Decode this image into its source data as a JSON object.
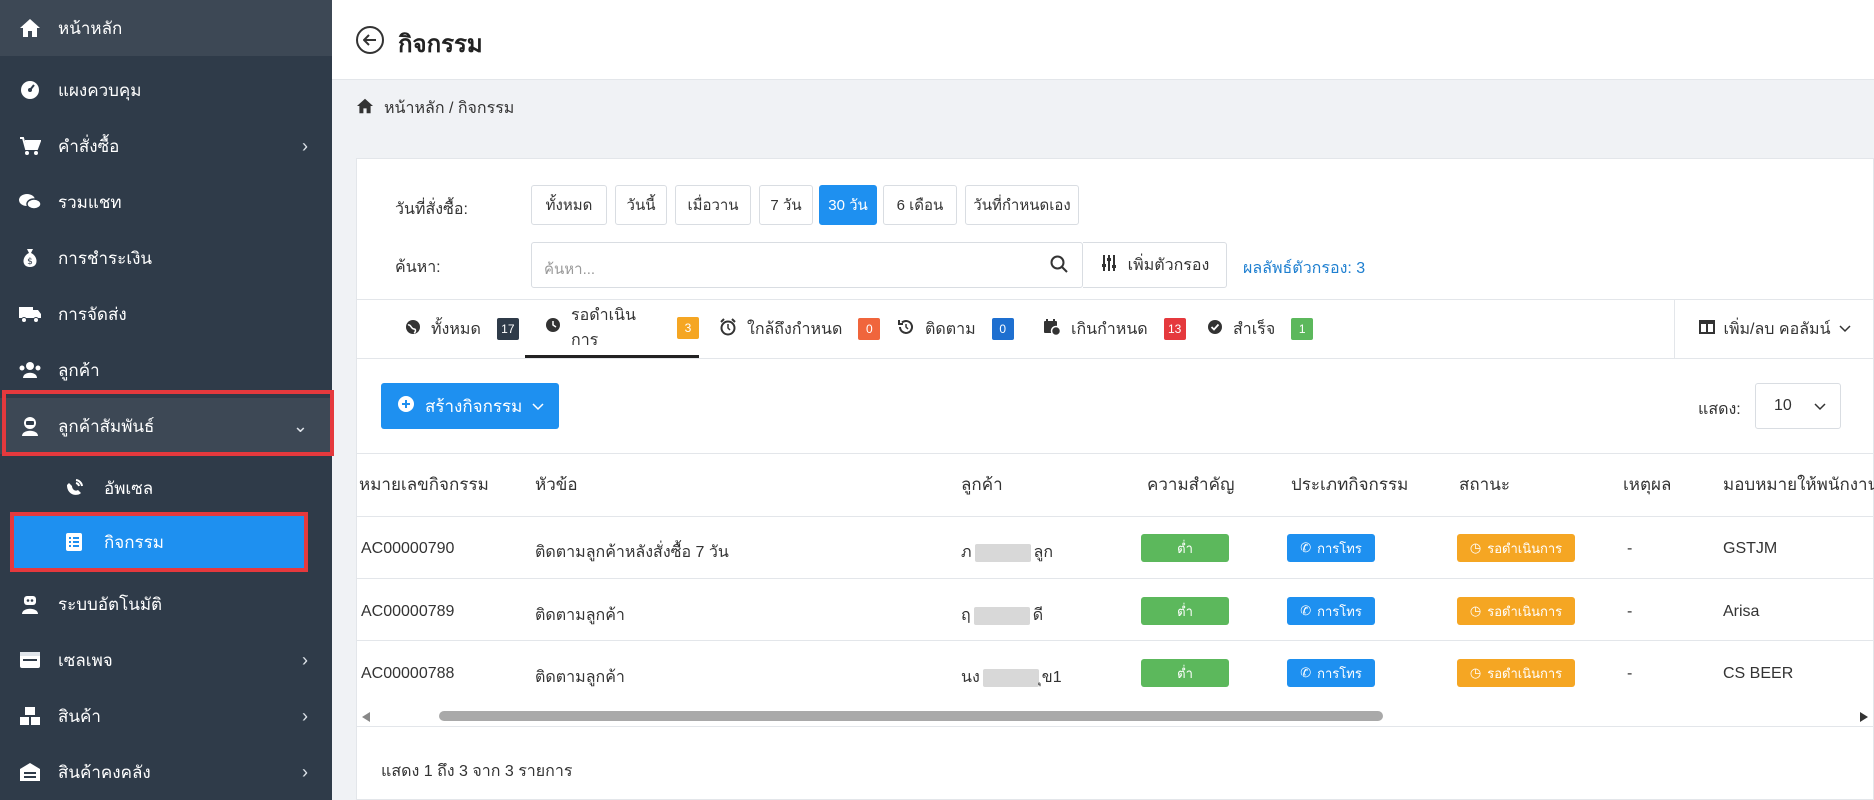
{
  "sidebar": {
    "items": [
      {
        "label": "หน้าหลัก",
        "icon": "home-icon"
      },
      {
        "label": "แผงควบคุม",
        "icon": "dashboard-icon"
      },
      {
        "label": "คำสั่งซื้อ",
        "icon": "cart-icon"
      },
      {
        "label": "รวมแชท",
        "icon": "chat-icon"
      },
      {
        "label": "การชำระเงิน",
        "icon": "money-bag-icon"
      },
      {
        "label": "การจัดส่ง",
        "icon": "truck-icon"
      },
      {
        "label": "ลูกค้า",
        "icon": "users-icon"
      },
      {
        "label": "ลูกค้าสัมพันธ์",
        "icon": "crm-icon"
      },
      {
        "label": "ระบบอัตโนมัติ",
        "icon": "robot-icon"
      },
      {
        "label": "เซลเพจ",
        "icon": "browser-icon"
      },
      {
        "label": "สินค้า",
        "icon": "boxes-icon"
      },
      {
        "label": "สินค้าคงคลัง",
        "icon": "warehouse-icon"
      }
    ],
    "sub_items": [
      {
        "label": "อัพเซล",
        "icon": "upsell-icon"
      },
      {
        "label": "กิจกรรม",
        "icon": "activity-list-icon"
      }
    ]
  },
  "header": {
    "title": "กิจกรรม"
  },
  "breadcrumb": {
    "text": "หน้าหลัก / กิจกรรม"
  },
  "filters": {
    "date_label": "วันที่สั่งซื้อ:",
    "date_options": [
      "ทั้งหมด",
      "วันนี้",
      "เมื่อวาน",
      "7 วัน",
      "30 วัน",
      "6 เดือน",
      "วันที่กำหนดเอง"
    ],
    "selected_date": "30 วัน",
    "search_label": "ค้นหา:",
    "search_placeholder": "ค้นหา...",
    "add_filter_label": "เพิ่มตัวกรอง",
    "filter_result": "ผลลัพธ์ตัวกรอง: 3"
  },
  "tabs": [
    {
      "label": "ทั้งหมด",
      "count": "17",
      "color": "#2f3b49"
    },
    {
      "label": "รอดำเนินการ",
      "count": "3",
      "color": "#f5a623"
    },
    {
      "label": "ใกล้ถึงกำหนด",
      "count": "0",
      "color": "#f0653c"
    },
    {
      "label": "ติดตาม",
      "count": "0",
      "color": "#1e6fd0"
    },
    {
      "label": "เกินกำหนด",
      "count": "13",
      "color": "#e5393d"
    },
    {
      "label": "สำเร็จ",
      "count": "1",
      "color": "#5cb85c"
    }
  ],
  "column_toggle_label": "เพิ่ม/ลบ คอลัมน์",
  "create_button_label": "สร้างกิจกรรม",
  "page_size": {
    "label": "แสดง:",
    "value": "10"
  },
  "table": {
    "headers": [
      "หมายเลขกิจกรรม",
      "หัวข้อ",
      "ลูกค้า",
      "ความสำคัญ",
      "ประเภทกิจกรรม",
      "สถานะ",
      "เหตุผล",
      "มอบหมายให้พนักงาน"
    ],
    "rows": [
      {
        "id": "AC00000790",
        "subject": "ติดตามลูกค้าหลังสั่งซื้อ 7 วัน",
        "customer_pre": "ภ",
        "customer_post": "ลูก",
        "priority": "ต่ำ",
        "type": "การโทร",
        "status": "รอดำเนินการ",
        "reason": "-",
        "assignee": "GSTJM"
      },
      {
        "id": "AC00000789",
        "subject": "ติดตามลูกค้า",
        "customer_pre": "ฤ",
        "customer_post": "ดี",
        "priority": "ต่ำ",
        "type": "การโทร",
        "status": "รอดำเนินการ",
        "reason": "-",
        "assignee": "Arisa"
      },
      {
        "id": "AC00000788",
        "subject": "ติดตามลูกค้า",
        "customer_pre": "นง",
        "customer_post": "ุข1",
        "priority": "ต่ำ",
        "type": "การโทร",
        "status": "รอดำเนินการ",
        "reason": "-",
        "assignee": "CS BEER"
      }
    ]
  },
  "footer": {
    "summary": "แสดง 1 ถึง 3 จาก 3 รายการ"
  },
  "colors": {
    "sidebar_bg": "#2f3b49",
    "accent": "#1e90f0",
    "highlight": "#e5393d"
  }
}
